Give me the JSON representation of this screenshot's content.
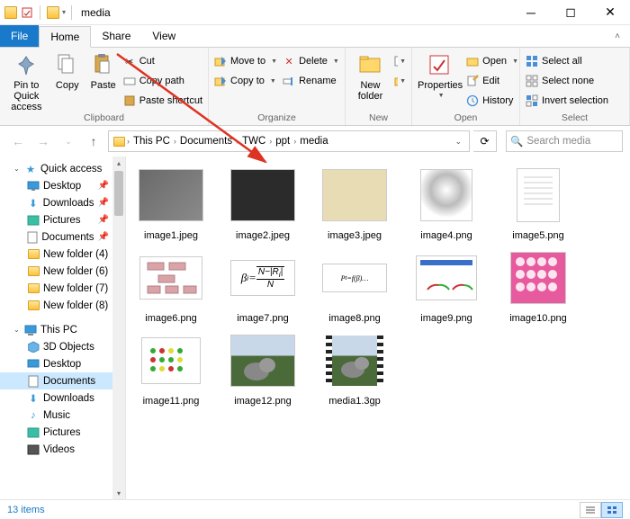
{
  "window": {
    "title": "media"
  },
  "tabs": {
    "file": "File",
    "home": "Home",
    "share": "Share",
    "view": "View"
  },
  "ribbon": {
    "clipboard": {
      "label": "Clipboard",
      "pin": "Pin to Quick\naccess",
      "copy": "Copy",
      "paste": "Paste",
      "cut": "Cut",
      "copy_path": "Copy path",
      "paste_shortcut": "Paste shortcut"
    },
    "organize": {
      "label": "Organize",
      "move_to": "Move to",
      "copy_to": "Copy to",
      "delete": "Delete",
      "rename": "Rename"
    },
    "new": {
      "label": "New",
      "new_folder": "New\nfolder"
    },
    "open": {
      "label": "Open",
      "properties": "Properties",
      "open": "Open",
      "edit": "Edit",
      "history": "History"
    },
    "select": {
      "label": "Select",
      "select_all": "Select all",
      "select_none": "Select none",
      "invert": "Invert selection"
    }
  },
  "breadcrumb": {
    "items": [
      "This PC",
      "Documents",
      "TWC",
      "ppt",
      "media"
    ]
  },
  "search": {
    "placeholder": "Search media"
  },
  "nav": {
    "quick_access": "Quick access",
    "desktop": "Desktop",
    "downloads": "Downloads",
    "pictures": "Pictures",
    "documents": "Documents",
    "new_folder_4": "New folder (4)",
    "new_folder_6": "New folder (6)",
    "new_folder_7": "New folder (7)",
    "new_folder_8": "New folder (8)",
    "this_pc": "This PC",
    "objects_3d": "3D Objects",
    "desktop2": "Desktop",
    "documents2": "Documents",
    "downloads2": "Downloads",
    "music": "Music",
    "pictures2": "Pictures",
    "videos": "Videos"
  },
  "files": [
    {
      "name": "image1.jpeg"
    },
    {
      "name": "image2.jpeg"
    },
    {
      "name": "image3.jpeg"
    },
    {
      "name": "image4.png"
    },
    {
      "name": "image5.png"
    },
    {
      "name": "image6.png"
    },
    {
      "name": "image7.png"
    },
    {
      "name": "image8.png"
    },
    {
      "name": "image9.png"
    },
    {
      "name": "image10.png"
    },
    {
      "name": "image11.png"
    },
    {
      "name": "image12.png"
    },
    {
      "name": "media1.3gp"
    }
  ],
  "status": {
    "count": "13 items"
  }
}
